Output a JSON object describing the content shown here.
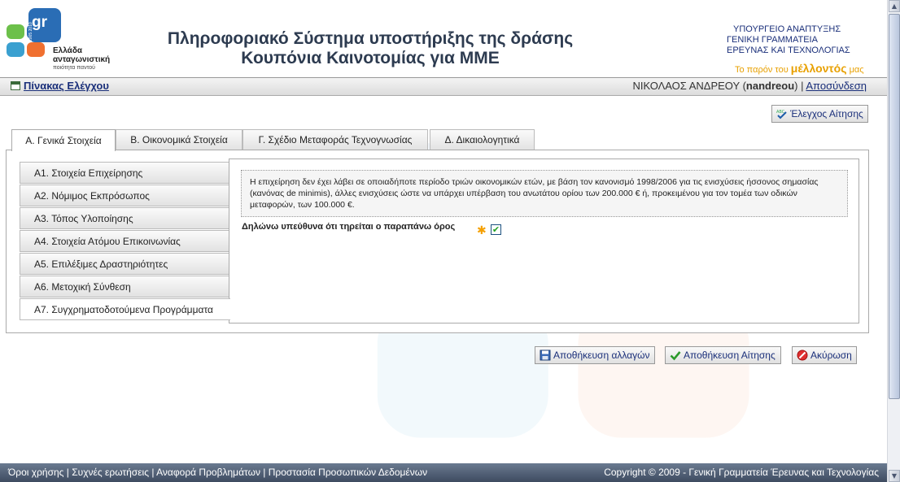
{
  "header": {
    "logo_line1": "Ελλάδα",
    "logo_line2": "ανταγωνιστική",
    "logo_line3": "ποιότητα παντού",
    "logo_mark": "gr",
    "logo_years": "2005 2010",
    "title_line1": "Πληροφοριακό Σύστημα υποστήριξης της δράσης",
    "title_line2": "Κουπόνια Καινοτομίας για ΜΜΕ",
    "ministry_line1": "ΥΠΟΥΡΓΕΙΟ ΑΝΑΠΤΥΞΗΣ",
    "ministry_line2": "ΓΕΝΙΚΗ ΓΡΑΜΜΑΤΕΙΑ",
    "ministry_line3": "ΕΡΕΥΝΑΣ ΚΑΙ ΤΕΧΝΟΛΟΓΙΑΣ",
    "motto_pre": "Το παρόν του",
    "motto_bold": "μέλλοντός",
    "motto_post": "μας"
  },
  "topbar": {
    "dashboard_label": "Πίνακας Ελέγχου",
    "user_name": "ΝΙΚΟΛΑΟΣ ΑΝΔΡΕΟΥ",
    "user_login": "nandreou",
    "separator": "|",
    "logout_label": "Αποσύνδεση"
  },
  "check_button": {
    "label": "Έλεγχος Αίτησης",
    "icon": "spellcheck-icon"
  },
  "tabs": [
    {
      "label": "Α. Γενικά Στοιχεία",
      "active": true
    },
    {
      "label": "Β. Οικονομικά Στοιχεία",
      "active": false
    },
    {
      "label": "Γ. Σχέδιο Μεταφοράς Τεχνογνωσίας",
      "active": false
    },
    {
      "label": "Δ. Δικαιολογητικά",
      "active": false
    }
  ],
  "sidebar": [
    {
      "label": "Α1. Στοιχεία Επιχείρησης",
      "active": false
    },
    {
      "label": "Α2. Νόμιμος Εκπρόσωπος",
      "active": false
    },
    {
      "label": "Α3. Τόπος Υλοποίησης",
      "active": false
    },
    {
      "label": "Α4. Στοιχεία Ατόμου Επικοινωνίας",
      "active": false
    },
    {
      "label": "Α5. Επιλέξιμες Δραστηριότητες",
      "active": false
    },
    {
      "label": "Α6. Μετοχική Σύνθεση",
      "active": false
    },
    {
      "label": "Α7. Συγχρηματοδοτούμενα Προγράμματα",
      "active": true
    }
  ],
  "notice_text": "Η επιχείρηση δεν έχει λάβει σε οποιαδήποτε περίοδο τριών οικονομικών ετών, με βάση τον κανονισμό 1998/2006 για τις ενισχύσεις ήσσονος σημασίας (κανόνας de minimis), άλλες ενισχύσεις ώστε να υπάρχει υπέρβαση του ανωτάτου ορίου των 200.000 € ή, προκειμένου για τον τομέα των οδικών μεταφορών, των 100.000 €.",
  "declaration": {
    "label": "Δηλώνω υπεύθυνα ότι τηρείται ο παραπάνω όρος",
    "required_mark": "✱",
    "checked": true
  },
  "actions": {
    "save_changes": "Αποθήκευση αλλαγών",
    "save_application": "Αποθήκευση Αίτησης",
    "cancel": "Ακύρωση"
  },
  "footer": {
    "links": [
      "Όροι χρήσης",
      "Συχνές ερωτήσεις",
      "Αναφορά Προβλημάτων",
      "Προστασία Προσωπικών Δεδομένων"
    ],
    "copyright": "Copyright © 2009 - Γενική Γραμματεία Έρευνας και Τεχνολογίας"
  },
  "colors": {
    "brand_blue": "#1a2f7a",
    "motto_orange": "#e8a000",
    "footer_bg": "#4e5b70"
  }
}
